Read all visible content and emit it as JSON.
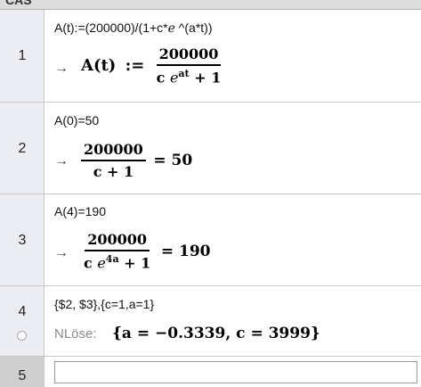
{
  "app": {
    "title": "CAS"
  },
  "rows": [
    {
      "number": "1",
      "input": "A(t):=(200000)/(1+c*ℯ ^(a*t))",
      "output": {
        "lhs": "A(t)",
        "op": ":=",
        "numerator": "200000",
        "den_c": "c",
        "den_e": "e",
        "den_exp": "at",
        "den_plus": "+ 1"
      }
    },
    {
      "number": "2",
      "input": "A(0)=50",
      "output": {
        "numerator": "200000",
        "den": "c + 1",
        "eq": "= 50"
      }
    },
    {
      "number": "3",
      "input": "A(4)=190",
      "output": {
        "numerator": "200000",
        "den_c": "c",
        "den_e": "e",
        "den_exp": "4a",
        "den_plus": "+ 1",
        "eq": "= 190"
      }
    },
    {
      "number": "4",
      "input": "{$2, $3},{c=1,a=1}",
      "command": "NLöse:",
      "output": "{a = −0.3339, c = 3999}"
    },
    {
      "number": "5",
      "input": ""
    }
  ],
  "arrow": "→"
}
